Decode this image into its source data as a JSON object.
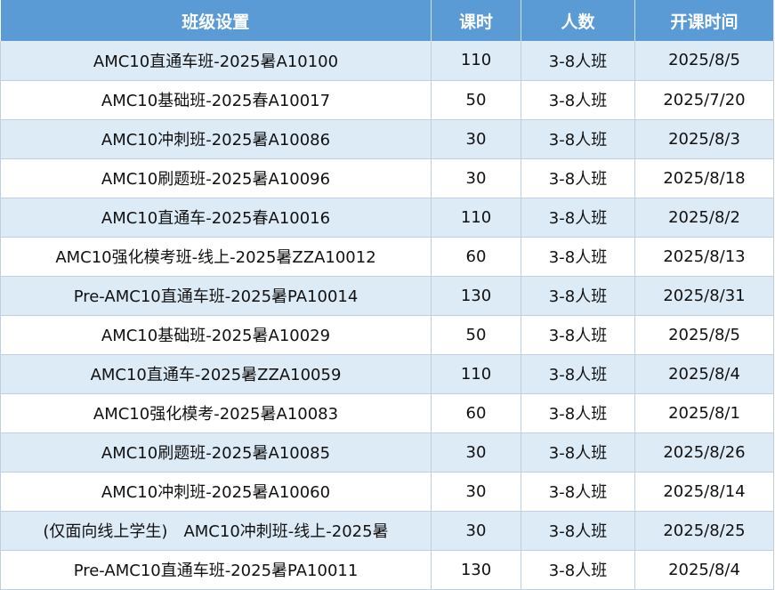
{
  "header": {
    "class": "班级设置",
    "hours": "课时",
    "size": "人数",
    "start": "开课时间"
  },
  "rows": [
    {
      "class": "AMC10直通车班-2025暑A10100",
      "hours": "110",
      "size": "3-8人班",
      "start": "2025/8/5"
    },
    {
      "class": "AMC10基础班-2025春A10017",
      "hours": "50",
      "size": "3-8人班",
      "start": "2025/7/20"
    },
    {
      "class": "AMC10冲刺班-2025暑A10086",
      "hours": "30",
      "size": "3-8人班",
      "start": "2025/8/3"
    },
    {
      "class": "AMC10刷题班-2025暑A10096",
      "hours": "30",
      "size": "3-8人班",
      "start": "2025/8/18"
    },
    {
      "class": "AMC10直通车-2025春A10016",
      "hours": "110",
      "size": "3-8人班",
      "start": "2025/8/2"
    },
    {
      "class": "AMC10强化模考班-线上-2025暑ZZA10012",
      "hours": "60",
      "size": "3-8人班",
      "start": "2025/8/13"
    },
    {
      "class": "Pre-AMC10直通车班-2025暑PA10014",
      "hours": "130",
      "size": "3-8人班",
      "start": "2025/8/31"
    },
    {
      "class": "AMC10基础班-2025暑A10029",
      "hours": "50",
      "size": "3-8人班",
      "start": "2025/8/5"
    },
    {
      "class": "AMC10直通车-2025暑ZZA10059",
      "hours": "110",
      "size": "3-8人班",
      "start": "2025/8/4"
    },
    {
      "class": "AMC10强化模考-2025暑A10083",
      "hours": "60",
      "size": "3-8人班",
      "start": "2025/8/1"
    },
    {
      "class": "AMC10刷题班-2025暑A10085",
      "hours": "30",
      "size": "3-8人班",
      "start": "2025/8/26"
    },
    {
      "class": "AMC10冲刺班-2025暑A10060",
      "hours": "30",
      "size": "3-8人班",
      "start": "2025/8/14"
    },
    {
      "class": "(仅面向线上学生)　AMC10冲刺班-线上-2025暑",
      "hours": "30",
      "size": "3-8人班",
      "start": "2025/8/25"
    },
    {
      "class": "Pre-AMC10直通车班-2025暑PA10011",
      "hours": "130",
      "size": "3-8人班",
      "start": "2025/8/4"
    }
  ],
  "colors": {
    "header_bg": "#5b9bd5",
    "header_text": "#ffffff",
    "band": "#ddebf7",
    "grid": "#bfcfe0"
  }
}
